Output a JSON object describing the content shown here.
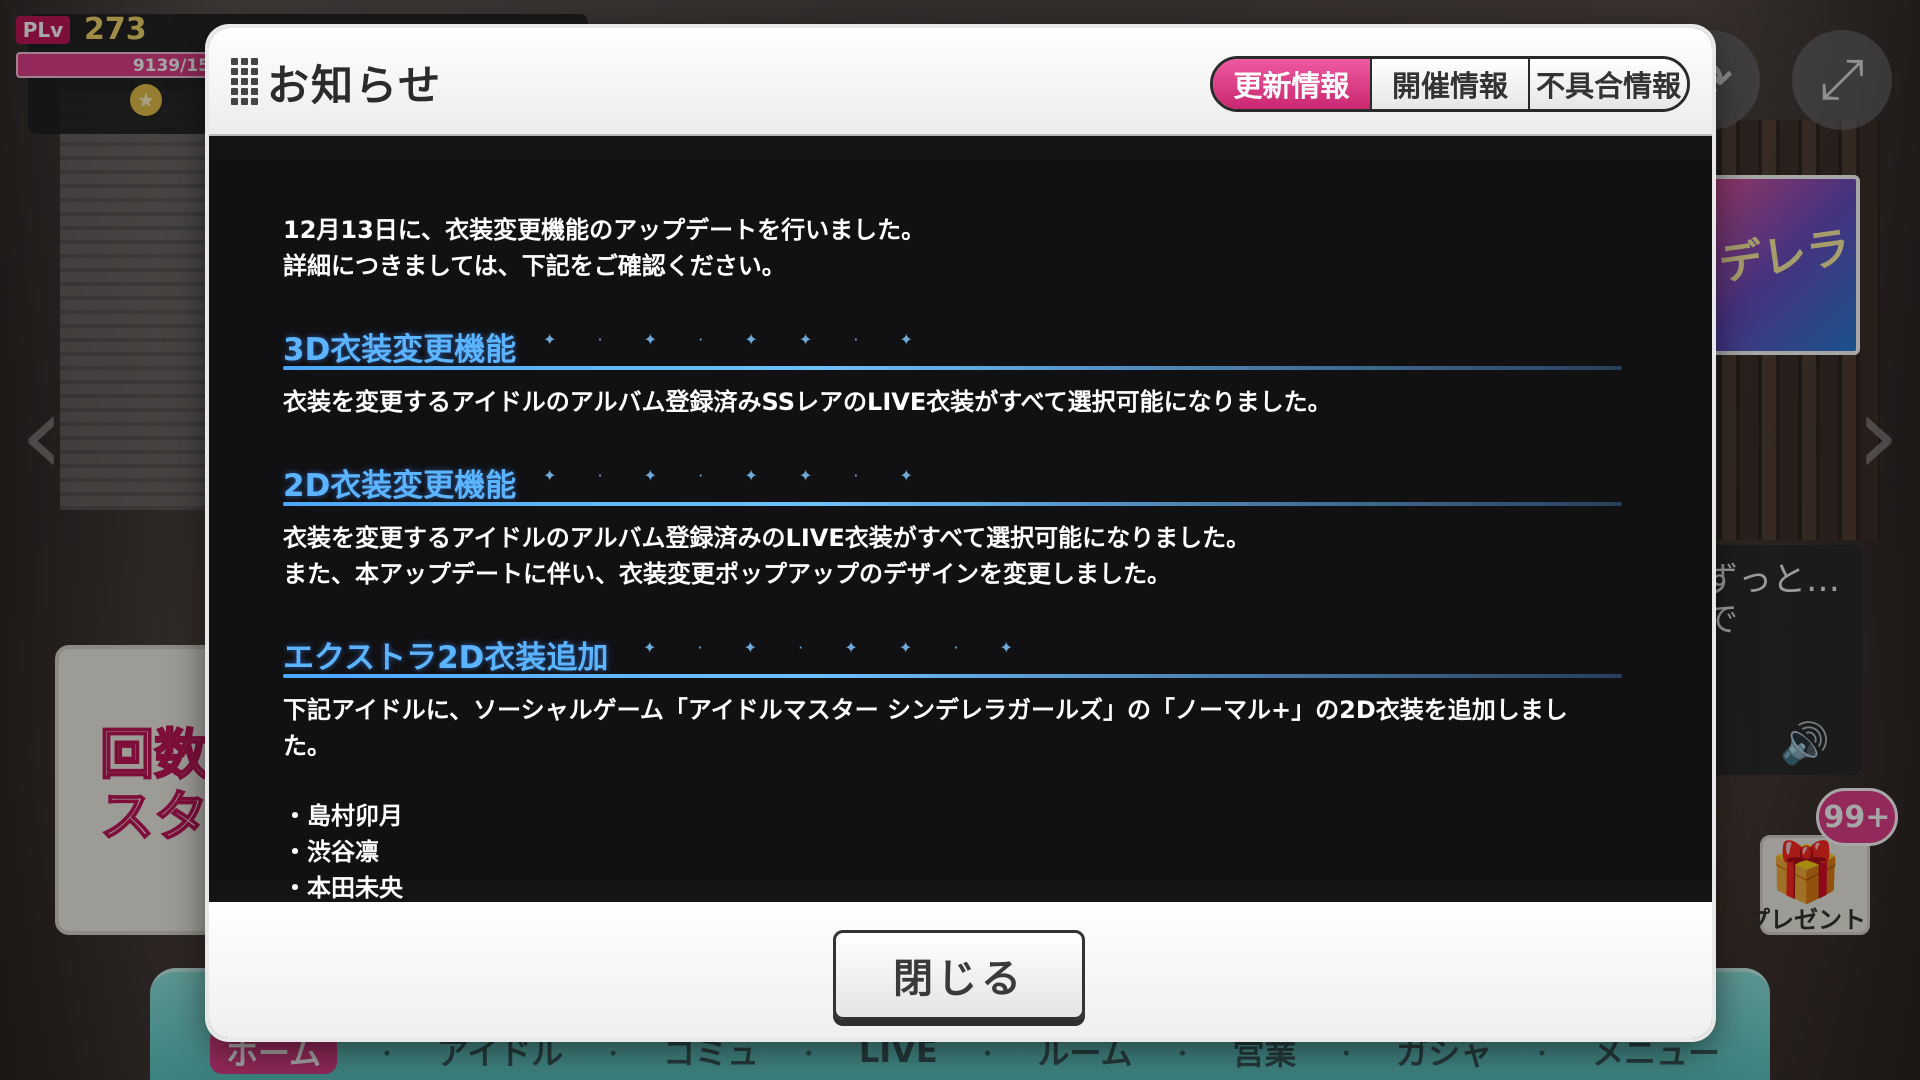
{
  "hud": {
    "plv_label": "PLv",
    "plv_value": "273",
    "exp_text": "9139/15",
    "star_icon": "★"
  },
  "background": {
    "gacha_text_1": "回数",
    "gacha_text_2": "スタ",
    "event_text": "デレラ",
    "chat_text": "ずっと…で",
    "nav": {
      "items": [
        "ホーム",
        "アイドル",
        "コミュ",
        "LIVE",
        "ルーム",
        "営業",
        "ガシャ",
        "メニュー"
      ],
      "separator": "・",
      "active_index": 0
    },
    "present": {
      "label": "プレゼント",
      "badge": "99+",
      "icon": "gift-icon"
    },
    "buttons": {
      "rotate_icon": "rotate-icon",
      "expand_icon": "expand-icon"
    },
    "arrows": {
      "left": "‹",
      "right": "›"
    }
  },
  "modal": {
    "title": "お知らせ",
    "tabs": [
      {
        "label": "更新情報",
        "active": true
      },
      {
        "label": "開催情報",
        "active": false
      },
      {
        "label": "不具合情報",
        "active": false
      }
    ],
    "intro": [
      "12月13日に、衣装変更機能のアップデートを行いました。",
      "詳細につきましては、下記をご確認ください。"
    ],
    "sections": [
      {
        "title": "3D衣装変更機能",
        "lines": [
          "衣装を変更するアイドルのアルバム登録済みSSレアのLIVE衣装がすべて選択可能になりました。"
        ]
      },
      {
        "title": "2D衣装変更機能",
        "lines": [
          "衣装を変更するアイドルのアルバム登録済みのLIVE衣装がすべて選択可能になりました。",
          "また、本アップデートに伴い、衣装変更ポップアップのデザインを変更しました。"
        ]
      },
      {
        "title": "エクストラ2D衣装追加",
        "lines": [
          "下記アイドルに、ソーシャルゲーム「アイドルマスター シンデレラガールズ」の「ノーマル+」の2D衣装を追加しまし",
          "た。"
        ]
      }
    ],
    "idols": [
      "・島村卯月",
      "・渋谷凛",
      "・本田未央"
    ],
    "close_label": "閉じる"
  },
  "colors": {
    "accent_pink": "#e0408a",
    "section_blue": "#5cb4ff",
    "body_bg": "#111113"
  }
}
